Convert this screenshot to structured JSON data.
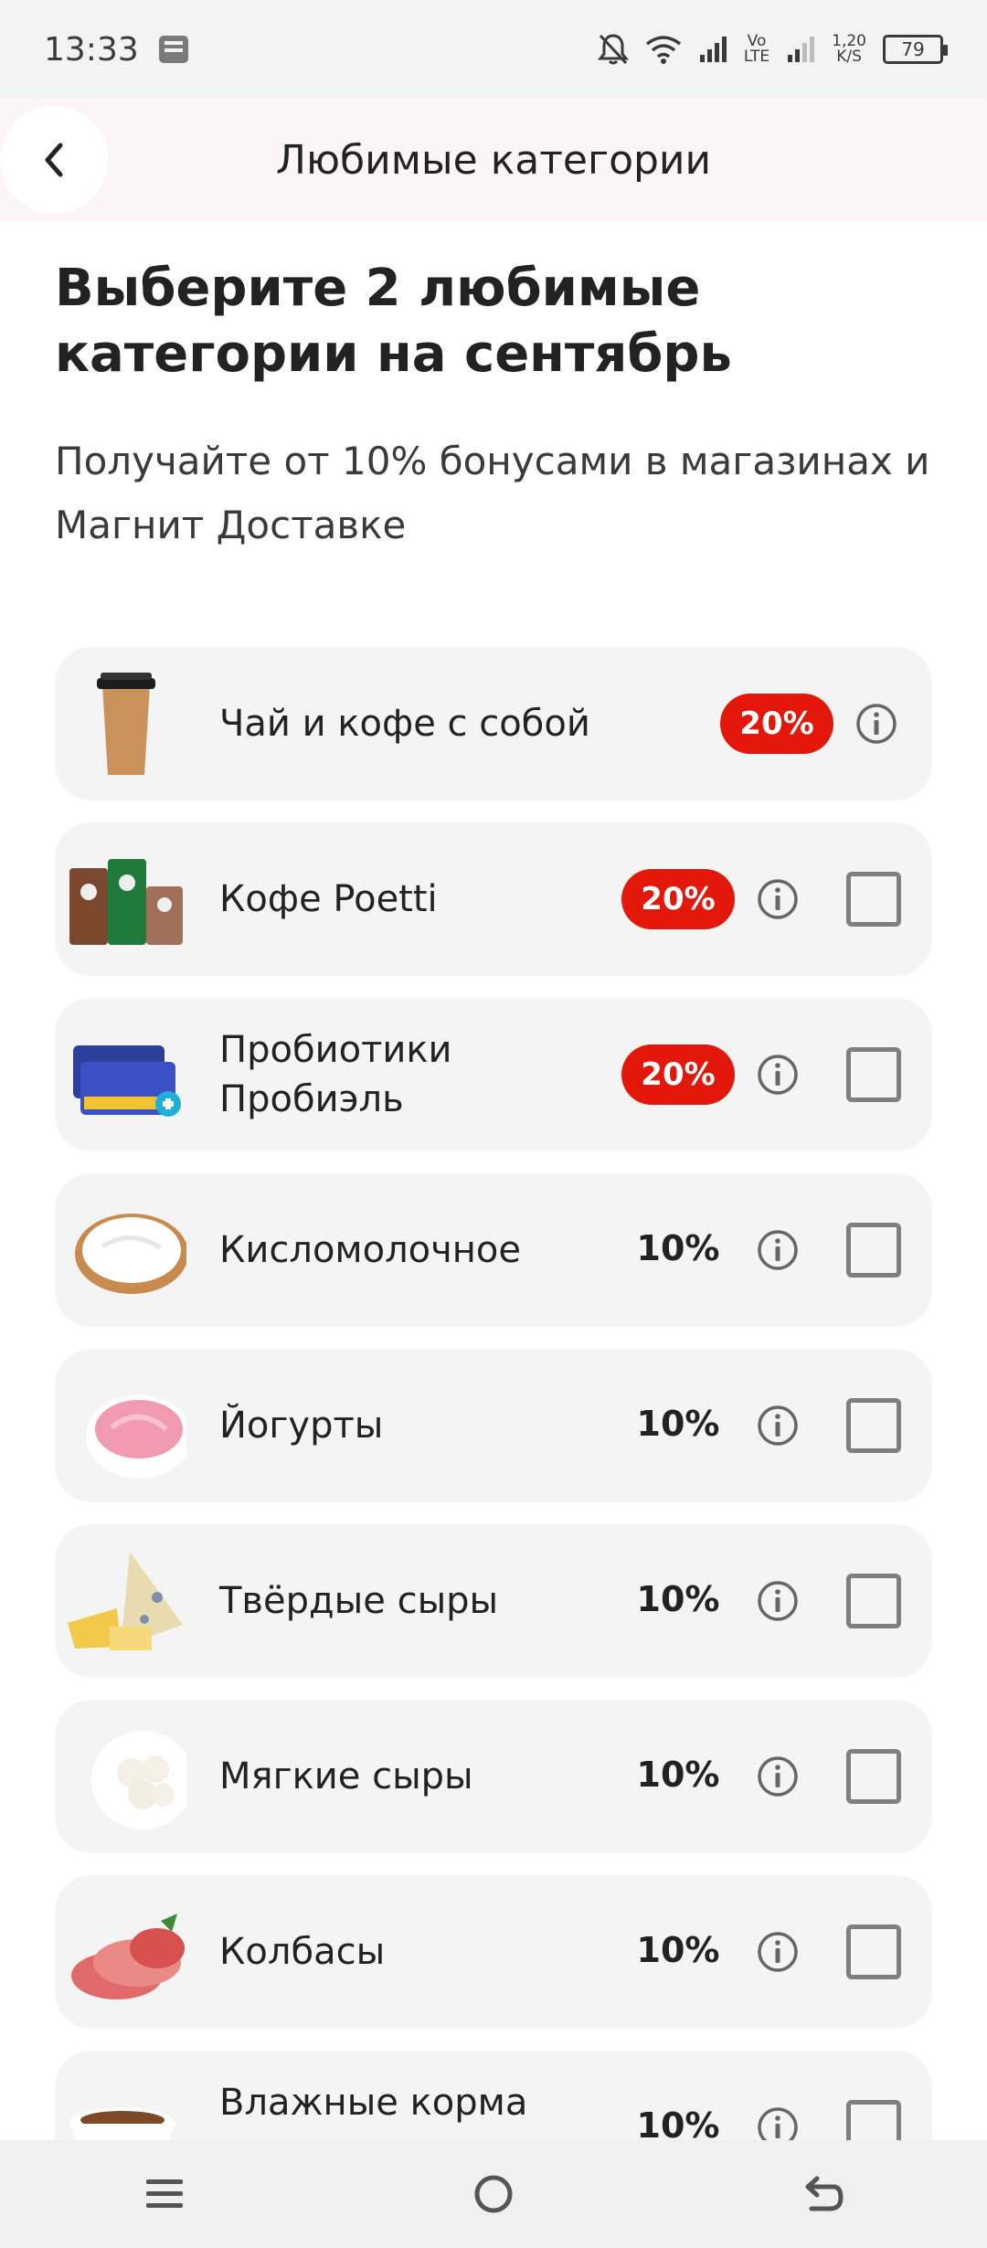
{
  "status_bar": {
    "time": "13:33",
    "network_speed_value": "1,20",
    "network_speed_unit": "K/S",
    "volte_top": "Vo",
    "volte_bottom": "LTE",
    "battery": "79"
  },
  "header": {
    "title": "Любимые категории"
  },
  "main": {
    "heading": "Выберите 2 любимые категории на сентябрь",
    "subheading": "Получайте от 10% бонусами в магазинах и Магнит Доставке"
  },
  "categories": [
    {
      "label": "Чай и кофе с собой",
      "percent": "20%",
      "highlight": true,
      "has_checkbox": false,
      "thumb": "coffee-cup-icon"
    },
    {
      "label": "Кофе Poetti",
      "percent": "20%",
      "highlight": true,
      "has_checkbox": true,
      "thumb": "coffee-packs-icon"
    },
    {
      "label": "Пробиотики Пробиэль",
      "percent": "20%",
      "highlight": true,
      "has_checkbox": true,
      "thumb": "probiotic-box-icon"
    },
    {
      "label": "Кисломолочное",
      "percent": "10%",
      "highlight": false,
      "has_checkbox": true,
      "thumb": "sour-cream-icon"
    },
    {
      "label": "Йогурты",
      "percent": "10%",
      "highlight": false,
      "has_checkbox": true,
      "thumb": "yogurt-bowl-icon"
    },
    {
      "label": "Твёрдые сыры",
      "percent": "10%",
      "highlight": false,
      "has_checkbox": true,
      "thumb": "hard-cheese-icon"
    },
    {
      "label": "Мягкие сыры",
      "percent": "10%",
      "highlight": false,
      "has_checkbox": true,
      "thumb": "mozzarella-icon"
    },
    {
      "label": "Колбасы",
      "percent": "10%",
      "highlight": false,
      "has_checkbox": true,
      "thumb": "sausage-slices-icon"
    },
    {
      "label": "Влажные корма для",
      "percent": "10%",
      "highlight": false,
      "has_checkbox": true,
      "thumb": "pet-food-bowl-icon"
    }
  ],
  "colors": {
    "accent": "#e3170a",
    "card_bg": "#f4f4f4",
    "header_bg": "#fcf5f7"
  },
  "nav": {
    "recents": "menu-icon",
    "home": "home-circle-icon",
    "back": "back-arrow-icon"
  }
}
